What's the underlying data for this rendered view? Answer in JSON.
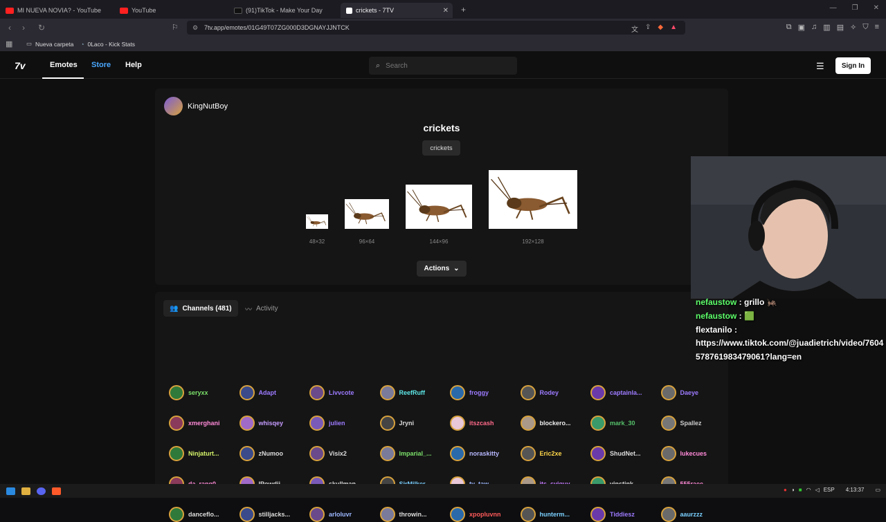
{
  "browser": {
    "tabs": [
      {
        "title": "MI NUEVA NOVIA? - YouTube",
        "favicon_color": "#ff2020"
      },
      {
        "title": "YouTube",
        "favicon_color": "#ff2020"
      },
      {
        "title": "(91)TikTok - Make Your Day",
        "favicon_color": "#111111"
      },
      {
        "title": "crickets - 7TV",
        "favicon_color": "#ffffff"
      }
    ],
    "new_tab": "+",
    "url": "7tv.app/emotes/01G49T07ZG000D3DGNAYJJNTCK",
    "bookmarks": [
      {
        "label": "Nueva carpeta",
        "icon": "folder-icon"
      },
      {
        "label": "0Laco - Kick Stats",
        "icon": "kick-icon"
      }
    ]
  },
  "site": {
    "logo": "7v",
    "nav": {
      "emotes": "Emotes",
      "store": "Store",
      "help": "Help"
    },
    "search_placeholder": "Search",
    "signin": "Sign In",
    "accent": "#4aa8ff"
  },
  "emote": {
    "author": "KingNutBoy",
    "title": "crickets",
    "tag": "crickets",
    "sizes": [
      "48×32",
      "96×64",
      "144×96",
      "192×128"
    ],
    "actions": "Actions"
  },
  "channels": {
    "tab_channels": "Channels (481)",
    "tab_activity": "Activity",
    "users": [
      {
        "name": "seryxx",
        "color": "#7be06a"
      },
      {
        "name": "Adapt",
        "color": "#9d7bff"
      },
      {
        "name": "Livvcote",
        "color": "#9d7bff"
      },
      {
        "name": "ReefRuff",
        "color": "#5ee8e8"
      },
      {
        "name": "froggy",
        "color": "#9d7bff"
      },
      {
        "name": "Rodey",
        "color": "#9d7bff"
      },
      {
        "name": "captainla...",
        "color": "#9d7bff"
      },
      {
        "name": "Daeye",
        "color": "#9d7bff"
      },
      {
        "name": "xmerghani",
        "color": "#ff8ad8"
      },
      {
        "name": "whisqey",
        "color": "#c59bff"
      },
      {
        "name": "julien",
        "color": "#9d7bff"
      },
      {
        "name": "Jryni",
        "color": "#dddddd"
      },
      {
        "name": "itszcash",
        "color": "#ff6a8a"
      },
      {
        "name": "blockero...",
        "color": "#eeeeee"
      },
      {
        "name": "mark_30",
        "color": "#55c06a"
      },
      {
        "name": "Spallez",
        "color": "#cccccc"
      },
      {
        "name": "Ninjaturt...",
        "color": "#d6f56a"
      },
      {
        "name": "zNumoo",
        "color": "#dddddd"
      },
      {
        "name": "Visix2",
        "color": "#dddddd"
      },
      {
        "name": "Imparial_...",
        "color": "#7be06a"
      },
      {
        "name": "noraskitty",
        "color": "#b8b8ff"
      },
      {
        "name": "Eric2xe",
        "color": "#ffd84a"
      },
      {
        "name": "ShudNet...",
        "color": "#dddddd"
      },
      {
        "name": "lukecues",
        "color": "#ff8ad8"
      },
      {
        "name": "da_rang0",
        "color": "#ff8ad8"
      },
      {
        "name": "IPowdii",
        "color": "#dddddd"
      },
      {
        "name": "skullman...",
        "color": "#dddddd"
      },
      {
        "name": "SirMilker...",
        "color": "#7ad0ff"
      },
      {
        "name": "ty_taw_",
        "color": "#9db8ff"
      },
      {
        "name": "its_sviquy",
        "color": "#c77bff"
      },
      {
        "name": "vinstink",
        "color": "#dddddd"
      },
      {
        "name": "555raee",
        "color": "#ff8ad8"
      },
      {
        "name": "danceflo...",
        "color": "#dddddd"
      },
      {
        "name": "stilljacks...",
        "color": "#dddddd"
      },
      {
        "name": "arloluvr",
        "color": "#9db8ff"
      },
      {
        "name": "throwin...",
        "color": "#dddddd"
      },
      {
        "name": "xpopluvnn",
        "color": "#ff5a5a"
      },
      {
        "name": "hunterm...",
        "color": "#7ad0ff"
      },
      {
        "name": "Tiddiesz",
        "color": "#9d7bff"
      },
      {
        "name": "aaurzzz",
        "color": "#7ad0ff"
      }
    ]
  },
  "chat": {
    "messages": [
      {
        "user": "nefaustow",
        "text": "grillo 🦗"
      },
      {
        "user": "nefaustow",
        "text": "🟩"
      },
      {
        "user": "flextanilo",
        "text": "https://www.tiktok.com/@juadietrich/video/7604578761983479061?lang=en"
      }
    ]
  },
  "taskbar": {
    "lang": "ESP",
    "time": "4:13:37"
  }
}
